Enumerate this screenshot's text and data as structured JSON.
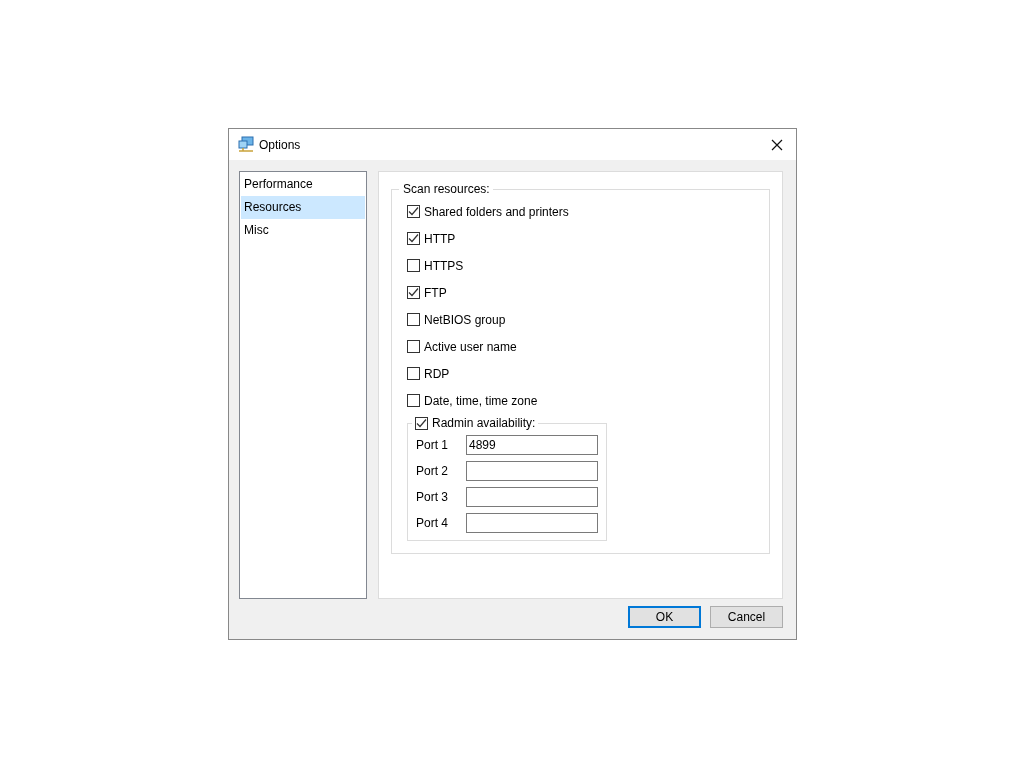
{
  "window": {
    "title": "Options"
  },
  "sidebar": {
    "items": [
      {
        "label": "Performance",
        "selected": false
      },
      {
        "label": "Resources",
        "selected": true
      },
      {
        "label": "Misc",
        "selected": false
      }
    ]
  },
  "scan_resources": {
    "title": "Scan resources:",
    "options": [
      {
        "label": "Shared folders and printers",
        "checked": true
      },
      {
        "label": "HTTP",
        "checked": true
      },
      {
        "label": "HTTPS",
        "checked": false
      },
      {
        "label": "FTP",
        "checked": true
      },
      {
        "label": "NetBIOS group",
        "checked": false
      },
      {
        "label": "Active user name",
        "checked": false
      },
      {
        "label": "RDP",
        "checked": false
      },
      {
        "label": "Date, time, time zone",
        "checked": false
      }
    ],
    "radmin": {
      "label": "Radmin availability:",
      "checked": true,
      "ports": [
        {
          "label": "Port 1",
          "value": "4899"
        },
        {
          "label": "Port 2"
        },
        {
          "label": "Port 3"
        },
        {
          "label": "Port 4"
        }
      ]
    }
  },
  "buttons": [
    {
      "label": "OK",
      "default": true
    },
    {
      "label": "Cancel",
      "default": false
    }
  ]
}
